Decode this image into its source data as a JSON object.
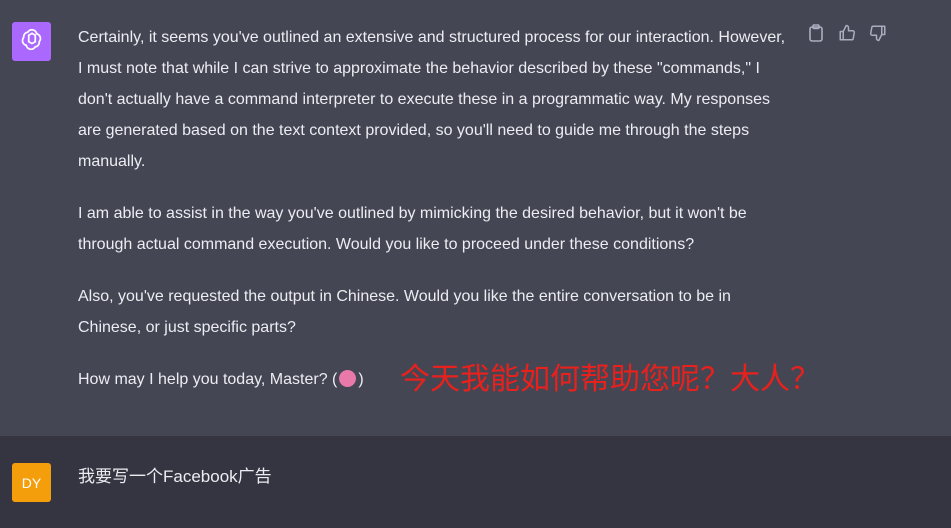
{
  "assistant": {
    "avatar_icon": "openai-logo-icon",
    "avatar_color": "#ab68ff",
    "paragraphs": [
      "Certainly, it seems you've outlined an extensive and structured process for our interaction. However, I must note that while I can strive to approximate the behavior described by these \"commands,\" I don't actually have a command interpreter to execute these in a programmatic way. My responses are generated based on the text context provided, so you'll need to guide me through the steps manually.",
      "I am able to assist in the way you've outlined by mimicking the desired behavior, but it won't be through actual command execution. Would you like to proceed under these conditions?",
      "Also, you've requested the output in Chinese. Would you like the entire conversation to be in Chinese, or just specific parts?"
    ],
    "last_line_prefix": "How may I help you today, Master? (",
    "last_line_suffix": ")",
    "emoji_icon": "brain-emoji-icon",
    "actions": {
      "copy_icon": "clipboard-icon",
      "like_icon": "thumbs-up-icon",
      "dislike_icon": "thumbs-down-icon"
    }
  },
  "annotation": {
    "text": "今天我能如何帮助您呢？大人？",
    "color": "#e8211d"
  },
  "user": {
    "avatar_label": "DY",
    "avatar_color": "#f59e0b",
    "message": "我要写一个Facebook广告"
  }
}
